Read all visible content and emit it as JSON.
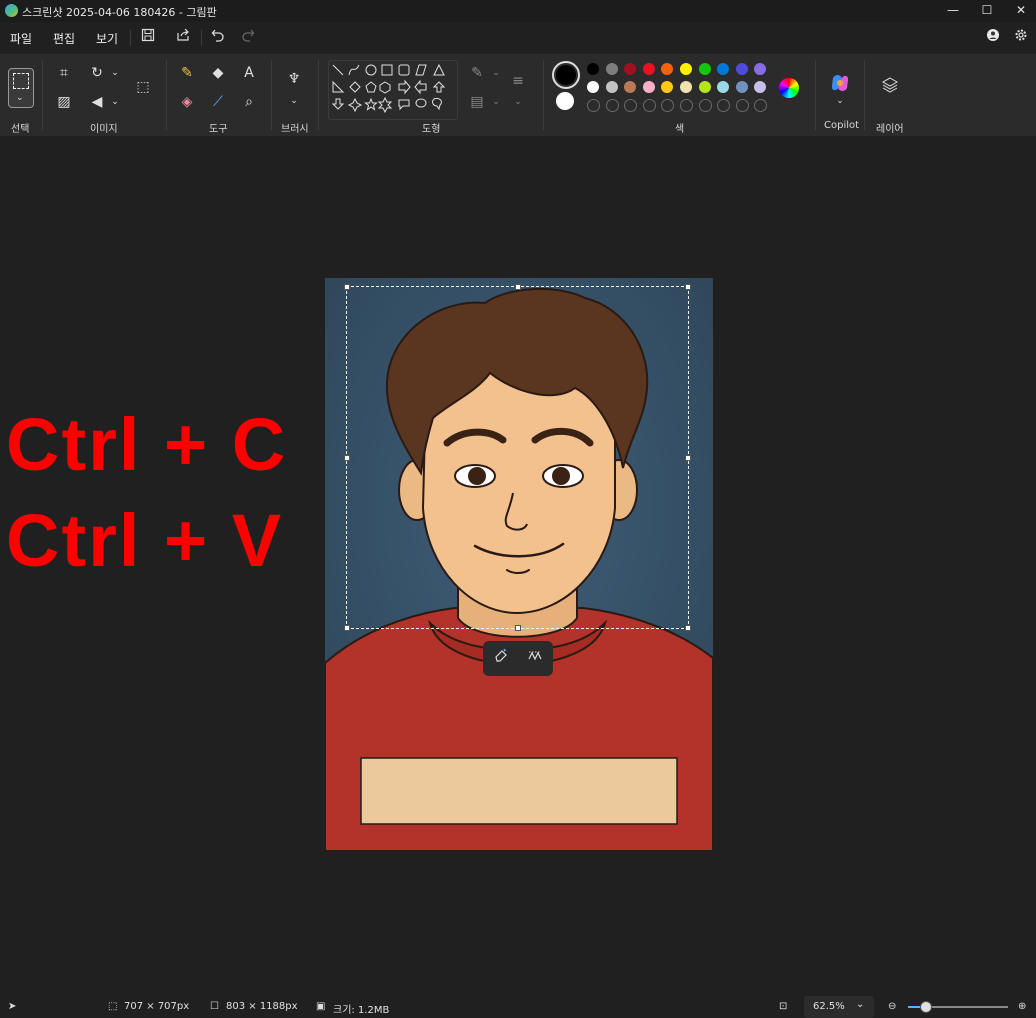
{
  "window": {
    "title": "스크린샷 2025-04-06 180426 - 그림판",
    "minimize_glyph": "—",
    "maximize_glyph": "☐",
    "close_glyph": "✕"
  },
  "menu": {
    "file": "파일",
    "edit": "편집",
    "view": "보기"
  },
  "ribbon": {
    "groups": {
      "select": "선택",
      "image": "이미지",
      "tools": "도구",
      "brush": "브러시",
      "shapes": "도형",
      "colors": "색",
      "copilot": "Copilot",
      "layers": "레이어"
    },
    "color_rows": [
      [
        "#000000",
        "#7f7f7f",
        "#a01020",
        "#e81224",
        "#f7630c",
        "#fff100",
        "#16c60c",
        "#0078d7",
        "#4f4bd9",
        "#886ce4"
      ],
      [
        "#ffffff",
        "#c3c3c3",
        "#b97a57",
        "#ffaec9",
        "#ffc90e",
        "#efe4b0",
        "#b5e61d",
        "#99d9ea",
        "#7092be",
        "#c8bfe7"
      ]
    ],
    "primary_color": "#000000",
    "secondary_color": "#ffffff"
  },
  "overlay": {
    "line1": "Ctrl + C",
    "line2": "Ctrl + V"
  },
  "status": {
    "selection_size": "707 × 707px",
    "canvas_size": "803 × 1188px",
    "file_size": "크기: 1.2MB",
    "zoom": "62.5%",
    "zoom_level": 0.0625
  }
}
